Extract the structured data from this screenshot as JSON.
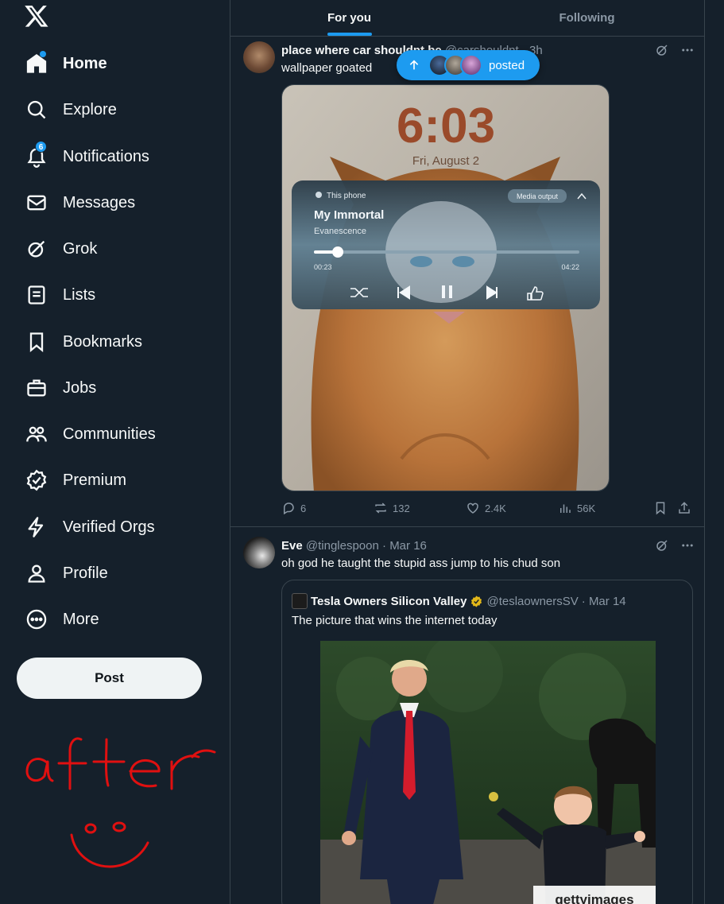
{
  "nav": {
    "items": [
      {
        "label": "Home",
        "icon": "home-icon"
      },
      {
        "label": "Explore",
        "icon": "search-icon"
      },
      {
        "label": "Notifications",
        "icon": "bell-icon",
        "badge": "6"
      },
      {
        "label": "Messages",
        "icon": "mail-icon"
      },
      {
        "label": "Grok",
        "icon": "grok-icon"
      },
      {
        "label": "Lists",
        "icon": "list-icon"
      },
      {
        "label": "Bookmarks",
        "icon": "bookmark-icon"
      },
      {
        "label": "Jobs",
        "icon": "briefcase-icon"
      },
      {
        "label": "Communities",
        "icon": "people-icon"
      },
      {
        "label": "Premium",
        "icon": "verified-badge-icon"
      },
      {
        "label": "Verified Orgs",
        "icon": "lightning-icon"
      },
      {
        "label": "Profile",
        "icon": "person-icon"
      },
      {
        "label": "More",
        "icon": "more-circle-icon"
      }
    ],
    "post_label": "Post"
  },
  "doodle_text": "after",
  "tabs": [
    {
      "label": "For you",
      "active": true
    },
    {
      "label": "Following",
      "active": false
    }
  ],
  "new_posts_pill": {
    "label": "posted"
  },
  "tweets": [
    {
      "name": "place where car shouldnt be",
      "handle": "@carshouldnt",
      "time": "3h",
      "text": "wallpaper goated",
      "image": {
        "clock": "6:03",
        "date": "Fri, August 2",
        "player_source": "This phone",
        "media_output": "Media output",
        "song": "My Immortal",
        "artist": "Evanescence",
        "elapsed": "00:23",
        "duration": "04:22",
        "progress": 0.09
      },
      "replies": "6",
      "reposts": "132",
      "likes": "2.4K",
      "views": "56K"
    },
    {
      "name": "Eve",
      "handle": "@tinglespoon",
      "time": "Mar 16",
      "text": "oh god he taught the stupid ass jump to his chud son",
      "quote": {
        "name": "Tesla Owners Silicon Valley",
        "handle": "@teslaownersSV",
        "time": "Mar 14",
        "text": "The picture that wins the internet today",
        "watermark": "gettyimages"
      }
    }
  ],
  "colors": {
    "background": "#15202b",
    "accent": "#1d9bf0",
    "border": "#38444d",
    "muted": "#8b98a5",
    "doodle": "#e01010",
    "verified": "#e2b719"
  }
}
